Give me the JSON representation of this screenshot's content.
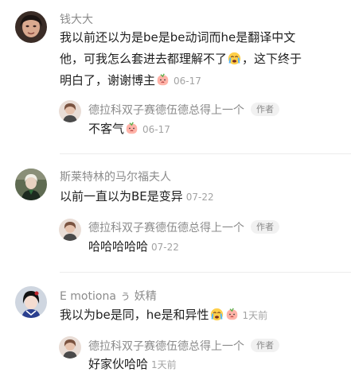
{
  "comments": [
    {
      "user": "钱大大",
      "text_line1": "我以前还以为是be是be动词而he是翻译中文",
      "text_line2a": "他，可我怎么套进去都理解不了",
      "text_line2b": "，这下终于",
      "text_line3": "明白了，谢谢博主",
      "time": "06-17",
      "reply": {
        "user": "德拉科双子赛德伍德总得上一个",
        "tag": "作者",
        "text": "不客气",
        "time": "06-17"
      }
    },
    {
      "user": "斯莱特林的马尔福夫人",
      "text": "以前一直以为BE是变异",
      "time": "07-22",
      "reply": {
        "user": "德拉科双子赛德伍德总得上一个",
        "tag": "作者",
        "text": "哈哈哈哈哈",
        "time": "07-22"
      }
    },
    {
      "user": "E motiona ぅ 妖精",
      "text": "我以为be是同，he是和异性",
      "time": "1天前",
      "reply": {
        "user": "德拉科双子赛德伍德总得上一个",
        "tag": "作者",
        "text": "好家伙哈哈",
        "time": "1天前"
      }
    }
  ],
  "icons": {
    "emoji_crying": "crying-emoji-icon",
    "emoji_peach": "peach-emoji-icon"
  }
}
